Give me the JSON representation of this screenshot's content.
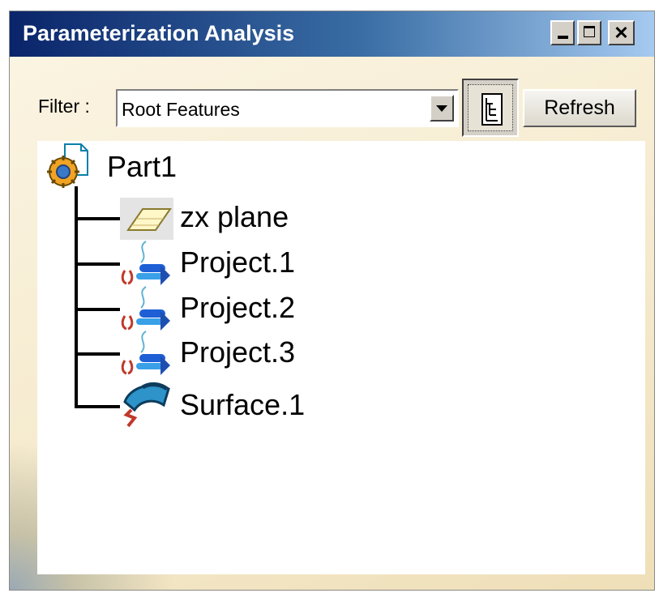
{
  "window": {
    "title": "Parameterization Analysis",
    "buttons": {
      "minimize_icon": "minimize-icon",
      "maximize_icon": "maximize-icon",
      "close_glyph": "✕"
    }
  },
  "filter": {
    "label": "Filter :",
    "selected": "Root Features",
    "tree_toggle_icon": "tree-view-icon"
  },
  "refresh_label": "Refresh",
  "tree": {
    "root": {
      "label": "Part1",
      "icon": "part-icon"
    },
    "children": [
      {
        "label": "zx plane",
        "icon": "plane-icon"
      },
      {
        "label": "Project.1",
        "icon": "projection-icon"
      },
      {
        "label": "Project.2",
        "icon": "projection-icon"
      },
      {
        "label": "Project.3",
        "icon": "projection-icon"
      },
      {
        "label": "Surface.1",
        "icon": "surface-icon"
      }
    ]
  },
  "colors": {
    "title_start": "#0a246a",
    "title_end": "#a6caf0",
    "panel_bg": "#f6ebcf"
  }
}
